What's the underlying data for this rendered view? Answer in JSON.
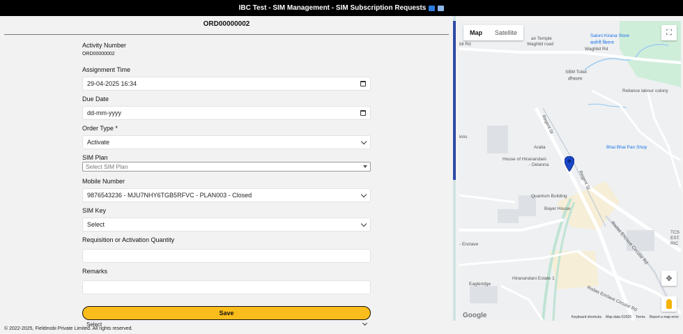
{
  "topbar": {
    "title": "IBC Test - SIM Management - SIM Subscription Requests"
  },
  "order": {
    "title": "ORD00000002"
  },
  "form": {
    "activity_number": {
      "label": "Activity Number",
      "value": "ORD00000002"
    },
    "assignment_time": {
      "label": "Assignment Time",
      "value": "29-04-2025 16:34"
    },
    "due_date": {
      "label": "Due Date",
      "value": "dd-mm-yyyy"
    },
    "order_type": {
      "label": "Order Type *",
      "value": "Activate"
    },
    "sim_plan": {
      "label": "SIM Plan",
      "placeholder": "Select SIM Plan"
    },
    "mobile_number": {
      "label": "Mobile Number",
      "value": "9876543236 - MJU7NHY6TGB5RFVC - PLAN003 - Closed"
    },
    "sim_key": {
      "label": "SIM Key",
      "value": "Select"
    },
    "quantity": {
      "label": "Requisition or Activation Quantity",
      "value": ""
    },
    "remarks": {
      "label": "Remarks",
      "value": ""
    },
    "save_label": "Save",
    "trailing_select": "Select"
  },
  "footer": {
    "copyright": "© 2022-2025, Fieldmobi Private Limited. All rights reserved."
  },
  "map": {
    "tabs": [
      "Map",
      "Satellite"
    ],
    "labels": {
      "temple": "an Temple",
      "temple2": "Waghbil road",
      "saloni": "Saloni Kirana Store",
      "saloni_hi": "सलोनी किराना",
      "waghbil_rd": "Waghbil Rd",
      "bil_rd": "bil Rd",
      "sbm": "SBM Toilet",
      "sbm_hi": "शौचालय",
      "reliance": "Reliance labour colony",
      "aralia": "Aralia",
      "house": "House of Hiranandani",
      "house2": "- Delanna",
      "bhai": "Bhai Bhai Pan Shop",
      "kins": "kins",
      "quantum": "Quantum Building",
      "bayer": "Bayer House",
      "regent": "Regent St",
      "enclave": "- Enclave",
      "eagleridge": "Eagleridge",
      "hiranandani1": "Hiranandani Estate 1",
      "rodas": "Rodas Enclave Circular Rd",
      "rodas2": "Rodas Enclave Circular Rd",
      "tcs": "TCS",
      "tcs2": "EST.",
      "tcs3": "RIC"
    },
    "attribution": [
      "Keyboard shortcuts",
      "Map data ©2025",
      "Terms",
      "Report a map error"
    ],
    "google": "Google"
  },
  "colors": {
    "accent": "#fbbd1b",
    "pin": "#1a47c8",
    "topbar": "#000000"
  }
}
